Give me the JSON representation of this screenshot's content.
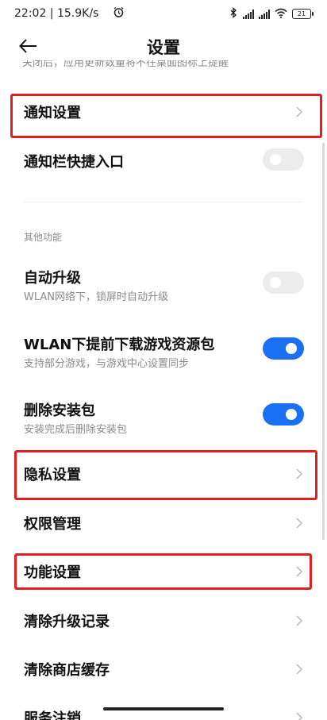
{
  "status_bar": {
    "time": "22:02 | 15.9K/s",
    "battery": "21"
  },
  "header": {
    "title": "设置"
  },
  "cutoff_text": "关闭后，应用更新数量将不在桌面图标上提醒",
  "rows": {
    "notification_settings": "通知设置",
    "notification_shortcut": "通知栏快捷入口",
    "auto_upgrade": "自动升级",
    "auto_upgrade_sub": "WLAN网络下，锁屏时自动升级",
    "wlan_predownload": "WLAN下提前下载游戏资源包",
    "wlan_predownload_sub": "支持部分游戏，与游戏中心设置同步",
    "delete_package": "删除安装包",
    "delete_package_sub": "安装完成后删除安装包",
    "privacy_settings": "隐私设置",
    "permission_management": "权限管理",
    "feature_settings": "功能设置",
    "clear_upgrade_records": "清除升级记录",
    "clear_store_cache": "清除商店缓存",
    "service_cancel": "服务注销"
  },
  "section": {
    "other_features": "其他功能"
  },
  "toggles": {
    "notification_shortcut": false,
    "auto_upgrade": false,
    "wlan_predownload": true,
    "delete_package": true
  },
  "colors": {
    "accent": "#1b6ff2",
    "highlight": "#e02020",
    "toggle_off": "#ececec",
    "secondary_text": "#8a8a8a"
  }
}
